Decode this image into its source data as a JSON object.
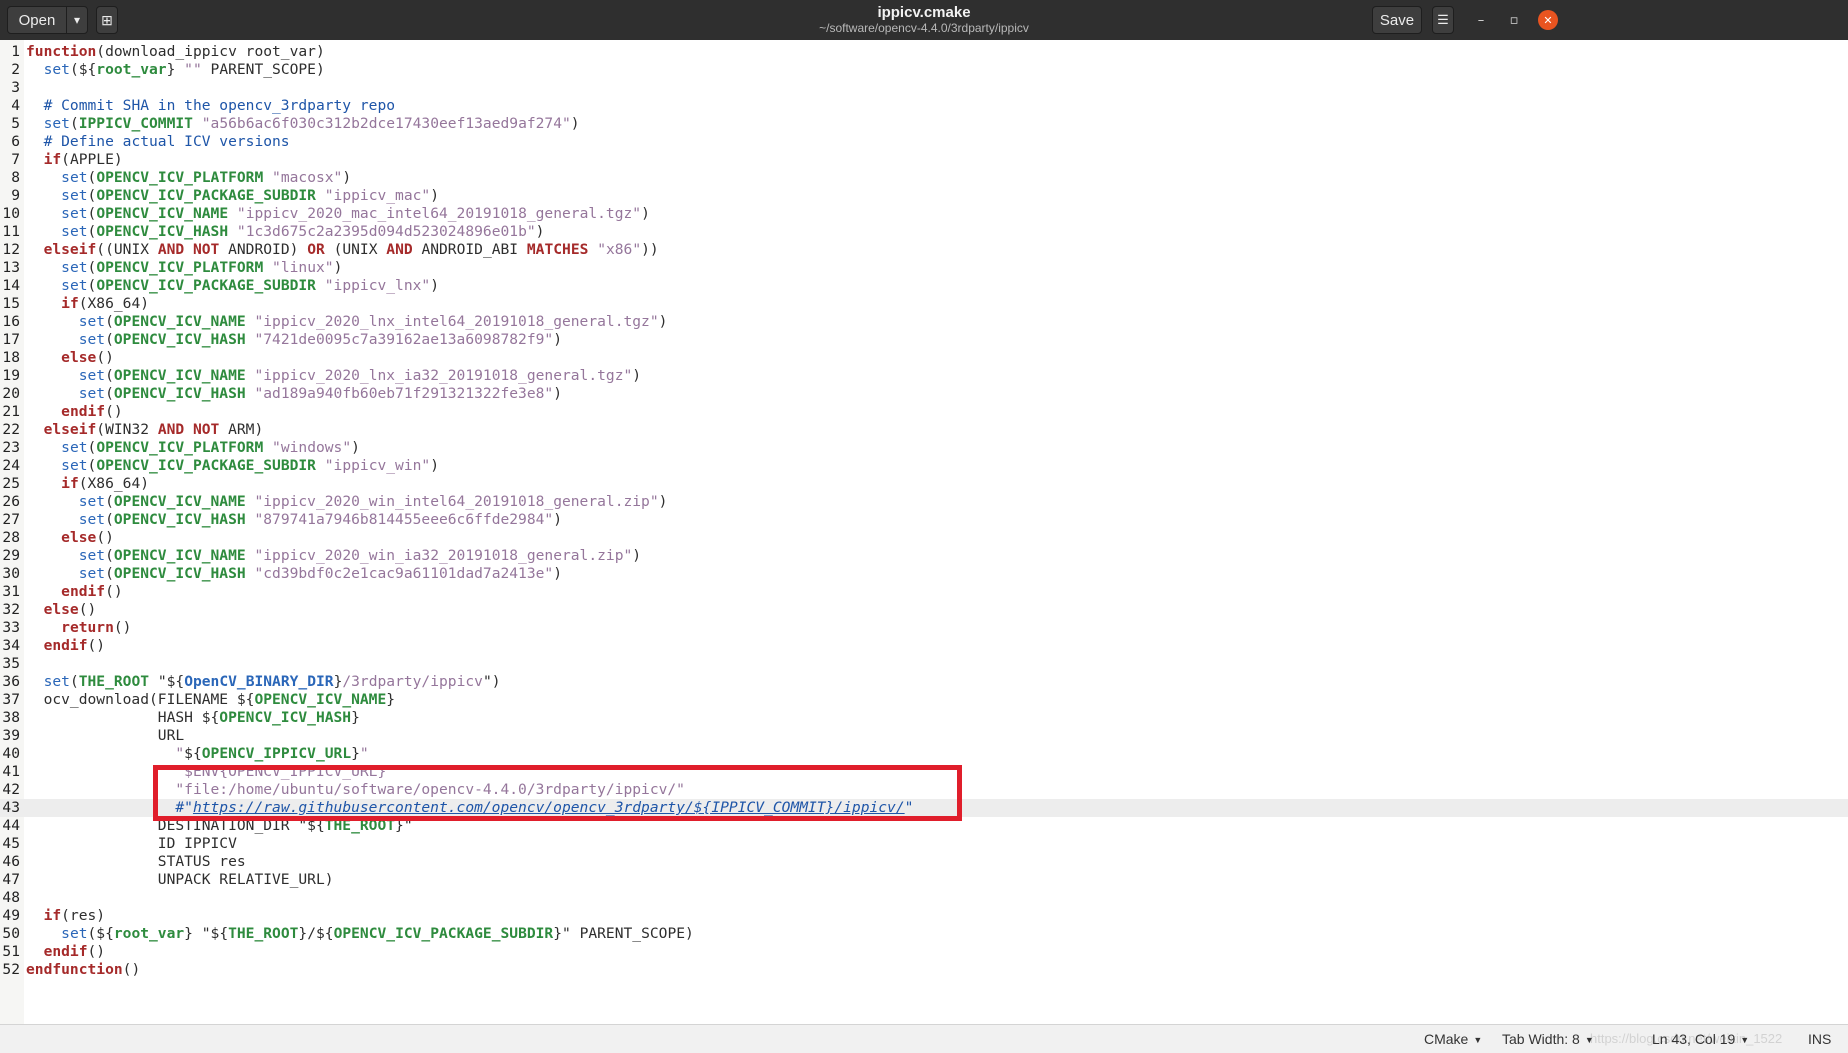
{
  "header": {
    "open_label": "Open",
    "dropdown_icon": "▾",
    "new_tab_icon": "⊞",
    "title": "ippicv.cmake",
    "subtitle": "~/software/opencv-4.4.0/3rdparty/ippicv",
    "save_label": "Save",
    "menu_icon": "☰",
    "minimize_icon": "–",
    "maximize_icon": "▫",
    "close_icon": "✕"
  },
  "editor": {
    "language": "CMake",
    "current_line": 43,
    "lines": [
      {
        "n": "1",
        "html": "<span class='kw'>function</span>(download_ippicv root_var)"
      },
      {
        "n": "2",
        "html": "  <span class='fn'>set</span>(${<span class='var'>root_var</span>} <span class='str'>\"\"</span> PARENT_SCOPE)"
      },
      {
        "n": "3",
        "html": ""
      },
      {
        "n": "4",
        "html": "  <span class='cm'># Commit SHA in the opencv_3rdparty repo</span>"
      },
      {
        "n": "5",
        "html": "  <span class='fn'>set</span>(<span class='var'>IPPICV_COMMIT</span> <span class='str'>\"a56b6ac6f030c312b2dce17430eef13aed9af274\"</span>)"
      },
      {
        "n": "6",
        "html": "  <span class='cm'># Define actual ICV versions</span>"
      },
      {
        "n": "7",
        "html": "  <span class='kw'>if</span>(APPLE)"
      },
      {
        "n": "8",
        "html": "    <span class='fn'>set</span>(<span class='var'>OPENCV_ICV_PLATFORM</span> <span class='str'>\"macosx\"</span>)"
      },
      {
        "n": "9",
        "html": "    <span class='fn'>set</span>(<span class='var'>OPENCV_ICV_PACKAGE_SUBDIR</span> <span class='str'>\"ippicv_mac\"</span>)"
      },
      {
        "n": "10",
        "html": "    <span class='fn'>set</span>(<span class='var'>OPENCV_ICV_NAME</span> <span class='str'>\"ippicv_2020_mac_intel64_20191018_general.tgz\"</span>)"
      },
      {
        "n": "11",
        "html": "    <span class='fn'>set</span>(<span class='var'>OPENCV_ICV_HASH</span> <span class='str'>\"1c3d675c2a2395d094d523024896e01b\"</span>)"
      },
      {
        "n": "12",
        "html": "  <span class='kw'>elseif</span>((UNIX <span class='kw'>AND NOT</span> ANDROID) <span class='kw'>OR</span> (UNIX <span class='kw'>AND</span> ANDROID_ABI <span class='kw'>MATCHES</span> <span class='str'>\"x86\"</span>))"
      },
      {
        "n": "13",
        "html": "    <span class='fn'>set</span>(<span class='var'>OPENCV_ICV_PLATFORM</span> <span class='str'>\"linux\"</span>)"
      },
      {
        "n": "14",
        "html": "    <span class='fn'>set</span>(<span class='var'>OPENCV_ICV_PACKAGE_SUBDIR</span> <span class='str'>\"ippicv_lnx\"</span>)"
      },
      {
        "n": "15",
        "html": "    <span class='kw'>if</span>(X86_64)"
      },
      {
        "n": "16",
        "html": "      <span class='fn'>set</span>(<span class='var'>OPENCV_ICV_NAME</span> <span class='str'>\"ippicv_2020_lnx_intel64_20191018_general.tgz\"</span>)"
      },
      {
        "n": "17",
        "html": "      <span class='fn'>set</span>(<span class='var'>OPENCV_ICV_HASH</span> <span class='str'>\"7421de0095c7a39162ae13a6098782f9\"</span>)"
      },
      {
        "n": "18",
        "html": "    <span class='kw'>else</span>()"
      },
      {
        "n": "19",
        "html": "      <span class='fn'>set</span>(<span class='var'>OPENCV_ICV_NAME</span> <span class='str'>\"ippicv_2020_lnx_ia32_20191018_general.tgz\"</span>)"
      },
      {
        "n": "20",
        "html": "      <span class='fn'>set</span>(<span class='var'>OPENCV_ICV_HASH</span> <span class='str'>\"ad189a940fb60eb71f291321322fe3e8\"</span>)"
      },
      {
        "n": "21",
        "html": "    <span class='kw'>endif</span>()"
      },
      {
        "n": "22",
        "html": "  <span class='kw'>elseif</span>(WIN32 <span class='kw'>AND NOT</span> ARM)"
      },
      {
        "n": "23",
        "html": "    <span class='fn'>set</span>(<span class='var'>OPENCV_ICV_PLATFORM</span> <span class='str'>\"windows\"</span>)"
      },
      {
        "n": "24",
        "html": "    <span class='fn'>set</span>(<span class='var'>OPENCV_ICV_PACKAGE_SUBDIR</span> <span class='str'>\"ippicv_win\"</span>)"
      },
      {
        "n": "25",
        "html": "    <span class='kw'>if</span>(X86_64)"
      },
      {
        "n": "26",
        "html": "      <span class='fn'>set</span>(<span class='var'>OPENCV_ICV_NAME</span> <span class='str'>\"ippicv_2020_win_intel64_20191018_general.zip\"</span>)"
      },
      {
        "n": "27",
        "html": "      <span class='fn'>set</span>(<span class='var'>OPENCV_ICV_HASH</span> <span class='str'>\"879741a7946b814455eee6c6ffde2984\"</span>)"
      },
      {
        "n": "28",
        "html": "    <span class='kw'>else</span>()"
      },
      {
        "n": "29",
        "html": "      <span class='fn'>set</span>(<span class='var'>OPENCV_ICV_NAME</span> <span class='str'>\"ippicv_2020_win_ia32_20191018_general.zip\"</span>)"
      },
      {
        "n": "30",
        "html": "      <span class='fn'>set</span>(<span class='var'>OPENCV_ICV_HASH</span> <span class='str'>\"cd39bdf0c2e1cac9a61101dad7a2413e\"</span>)"
      },
      {
        "n": "31",
        "html": "    <span class='kw'>endif</span>()"
      },
      {
        "n": "32",
        "html": "  <span class='kw'>else</span>()"
      },
      {
        "n": "33",
        "html": "    <span class='kw'>return</span>()"
      },
      {
        "n": "34",
        "html": "  <span class='kw'>endif</span>()"
      },
      {
        "n": "35",
        "html": ""
      },
      {
        "n": "36",
        "html": "  <span class='fn'>set</span>(<span class='var'>THE_ROOT</span> \"${<span class='var2'>OpenCV_BINARY_DIR</span>}<span class='str'>/3rdparty/ippicv</span>\")"
      },
      {
        "n": "37",
        "html": "  ocv_download(FILENAME ${<span class='var'>OPENCV_ICV_NAME</span>}"
      },
      {
        "n": "38",
        "html": "               HASH ${<span class='var'>OPENCV_ICV_HASH</span>}"
      },
      {
        "n": "39",
        "html": "               URL"
      },
      {
        "n": "40",
        "html": "                 <span class='str'>\"</span>${<span class='var'>OPENCV_IPPICV_URL</span>}<span class='str'>\"</span>"
      },
      {
        "n": "41",
        "html": "                 <span class='str'>\"$ENV{OPENCV_IPPICV_URL}\"</span>"
      },
      {
        "n": "42",
        "html": "                 <span class='str'>\"file:/home/ubuntu/software/opencv-4.4.0/3rdparty/ippicv/\"</span>"
      },
      {
        "n": "43",
        "html": "                 <span class='cm'>#\"<span class='url'>https://raw.githubusercontent.com/opencv/opencv_3rdparty/${IPPICV_COMMIT}/ippicv/</span>\"</span>"
      },
      {
        "n": "44",
        "html": "               DESTINATION_DIR \"${<span class='var'>THE_ROOT</span>}\""
      },
      {
        "n": "45",
        "html": "               ID IPPICV"
      },
      {
        "n": "46",
        "html": "               STATUS res"
      },
      {
        "n": "47",
        "html": "               UNPACK RELATIVE_URL)"
      },
      {
        "n": "48",
        "html": ""
      },
      {
        "n": "49",
        "html": "  <span class='kw'>if</span>(res)"
      },
      {
        "n": "50",
        "html": "    <span class='fn'>set</span>(${<span class='var'>root_var</span>} \"${<span class='var'>THE_ROOT</span>}/${<span class='var'>OPENCV_ICV_PACKAGE_SUBDIR</span>}\" PARENT_SCOPE)"
      },
      {
        "n": "51",
        "html": "  <span class='kw'>endif</span>()"
      },
      {
        "n": "52",
        "html": "<span class='kw'>endfunction</span>()"
      }
    ]
  },
  "status": {
    "language_label": "CMake",
    "tab_width_label": "Tab Width: 8",
    "position_label": "Ln 43, Col 19",
    "mode_label": "INS",
    "watermark": "https://blog.csdn.net/weixin_1522"
  },
  "colors": {
    "header_bg": "#2f2f2f",
    "keyword": "#a52a2a",
    "function": "#2a66b8",
    "variable": "#2e8b3e",
    "string": "#95769b",
    "comment": "#1e55a8",
    "highlight_box": "#e01e2b",
    "close_button": "#e95420"
  }
}
